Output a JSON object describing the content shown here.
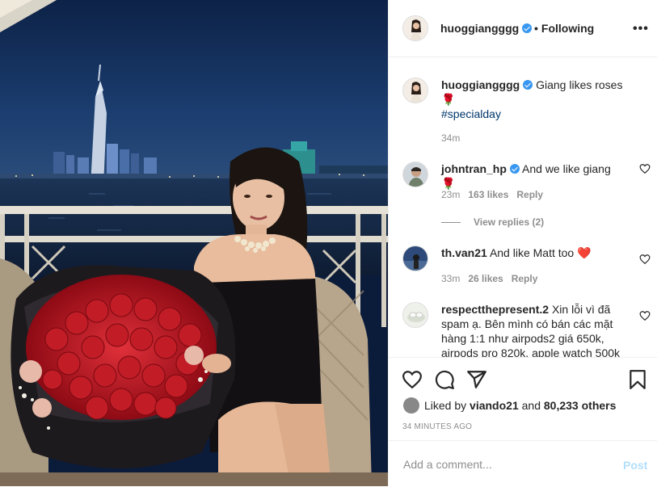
{
  "header": {
    "username": "huoggiangggg",
    "following_dot": "•",
    "following_label": "Following",
    "more_label": "•••"
  },
  "caption": {
    "username": "huoggiangggg",
    "text": "Giang likes roses 🌹",
    "hashtag": "#specialday",
    "time": "34m"
  },
  "comments": [
    {
      "username": "johntran_hp",
      "text": "And we like giang 🌹",
      "time": "23m",
      "likes": "163 likes",
      "reply": "Reply",
      "view_replies": "View replies (2)"
    },
    {
      "username": "th.van21",
      "text": "And like Matt too ❤️",
      "time": "33m",
      "likes": "26 likes",
      "reply": "Reply"
    },
    {
      "username": "respectthepresent.2",
      "text": "Xin lỗi vì đã spam ạ. Bên mình có bán các mặt hàng 1:1 như airpods2 giá 650k, airpods pro 820k, apple watch 500k"
    }
  ],
  "likes": {
    "prefix": "Liked by",
    "user": "viando21",
    "mid": "and",
    "others": "80,233 others"
  },
  "timestamp": "34 MINUTES AGO",
  "comment_box": {
    "placeholder": "Add a comment...",
    "post_label": "Post"
  },
  "colors": {
    "verified": "#3897f0",
    "hashtag": "#00376b",
    "muted": "#8e8e8e",
    "post_disabled": "#b2dffc",
    "heart_red": "#ed4956"
  },
  "icons": [
    "verified-badge",
    "heart-icon",
    "comment-icon",
    "share-icon",
    "bookmark-icon",
    "more-icon"
  ]
}
